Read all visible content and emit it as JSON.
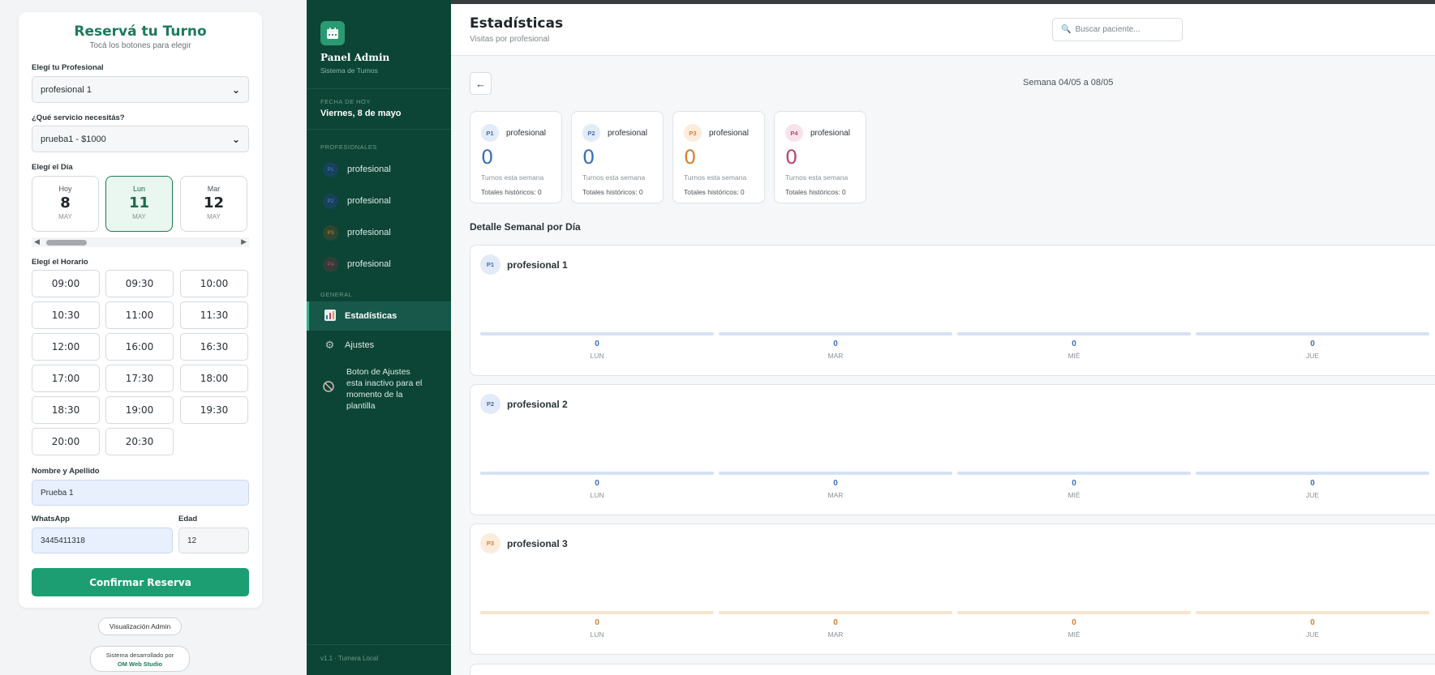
{
  "booking": {
    "title": "Reservá tu Turno",
    "subtitle": "Tocá los botones para elegir",
    "professional_label": "Elegí tu Profesional",
    "professional_value": "profesional 1",
    "service_label": "¿Qué servicio necesitás?",
    "service_value": "prueba1 - $1000",
    "day_label": "Elegí el Día",
    "days": [
      {
        "name": "Hoy",
        "num": "8",
        "month": "MAY"
      },
      {
        "name": "Lun",
        "num": "11",
        "month": "MAY"
      },
      {
        "name": "Mar",
        "num": "12",
        "month": "MAY"
      }
    ],
    "selected_day_index": 1,
    "time_label": "Elegí el Horario",
    "times": [
      "09:00",
      "09:30",
      "10:00",
      "10:30",
      "11:00",
      "11:30",
      "12:00",
      "16:00",
      "16:30",
      "17:00",
      "17:30",
      "18:00",
      "18:30",
      "19:00",
      "19:30",
      "20:00",
      "20:30"
    ],
    "name_label": "Nombre y Apellido",
    "name_value": "Prueba 1",
    "whatsapp_label": "WhatsApp",
    "whatsapp_value": "3445411318",
    "age_label": "Edad",
    "age_value": "12",
    "confirm_label": "Confirmar Reserva",
    "admin_link": "Visualización Admin",
    "credit_line1": "Sistema desarrollado por",
    "credit_brand": "OM Web Studio"
  },
  "sidebar": {
    "title": "Panel Admin",
    "subtitle": "Sistema de Turnos",
    "date_section": "FECHA DE HOY",
    "date_value": "Viernes, 8 de mayo",
    "pros_section": "PROFESIONALES",
    "professionals": [
      {
        "badge": "P1",
        "label": "profesional"
      },
      {
        "badge": "P2",
        "label": "profesional"
      },
      {
        "badge": "P3",
        "label": "profesional"
      },
      {
        "badge": "P4",
        "label": "profesional"
      }
    ],
    "general_section": "GENERAL",
    "stats_item": "Estadísticas",
    "settings_item": "Ajustes",
    "note": "Boton de Ajustes esta inactivo para el momento de la plantilla",
    "version": "v1.1 · Turnera Local"
  },
  "main": {
    "title": "Estadísticas",
    "subtitle": "Visitas por profesional",
    "search_placeholder": "Buscar paciente...",
    "back_arrow": "←",
    "week_label": "Semana 04/05 a 08/05",
    "stats": [
      {
        "badge": "P1",
        "name": "profesional",
        "count": "0",
        "week_label": "Turnos esta semana",
        "total_label": "Totales históricos: 0"
      },
      {
        "badge": "P2",
        "name": "profesional",
        "count": "0",
        "week_label": "Turnos esta semana",
        "total_label": "Totales históricos: 0"
      },
      {
        "badge": "P3",
        "name": "profesional",
        "count": "0",
        "week_label": "Turnos esta semana",
        "total_label": "Totales históricos: 0"
      },
      {
        "badge": "P4",
        "name": "profesional",
        "count": "0",
        "week_label": "Turnos esta semana",
        "total_label": "Totales históricos: 0"
      }
    ],
    "detail_title": "Detalle Semanal por Día",
    "panels": [
      {
        "badge": "P1",
        "name": "profesional 1",
        "days": [
          {
            "count": "0",
            "day": "LUN"
          },
          {
            "count": "0",
            "day": "MAR"
          },
          {
            "count": "0",
            "day": "MIÉ"
          },
          {
            "count": "0",
            "day": "JUE"
          }
        ]
      },
      {
        "badge": "P2",
        "name": "profesional 2",
        "days": [
          {
            "count": "0",
            "day": "LUN"
          },
          {
            "count": "0",
            "day": "MAR"
          },
          {
            "count": "0",
            "day": "MIÉ"
          },
          {
            "count": "0",
            "day": "JUE"
          }
        ]
      },
      {
        "badge": "P3",
        "name": "profesional 3",
        "days": [
          {
            "count": "0",
            "day": "LUN"
          },
          {
            "count": "0",
            "day": "MAR"
          },
          {
            "count": "0",
            "day": "MIÉ"
          },
          {
            "count": "0",
            "day": "JUE"
          }
        ]
      }
    ]
  },
  "colors": {
    "brand_green": "#1d7a5a",
    "confirm_green": "#1d9e72",
    "sidebar_bg": "#0c4535",
    "p1": "#3a6fb7",
    "p2": "#3a6fb7",
    "p3": "#d9802e",
    "p4": "#c0456b"
  }
}
